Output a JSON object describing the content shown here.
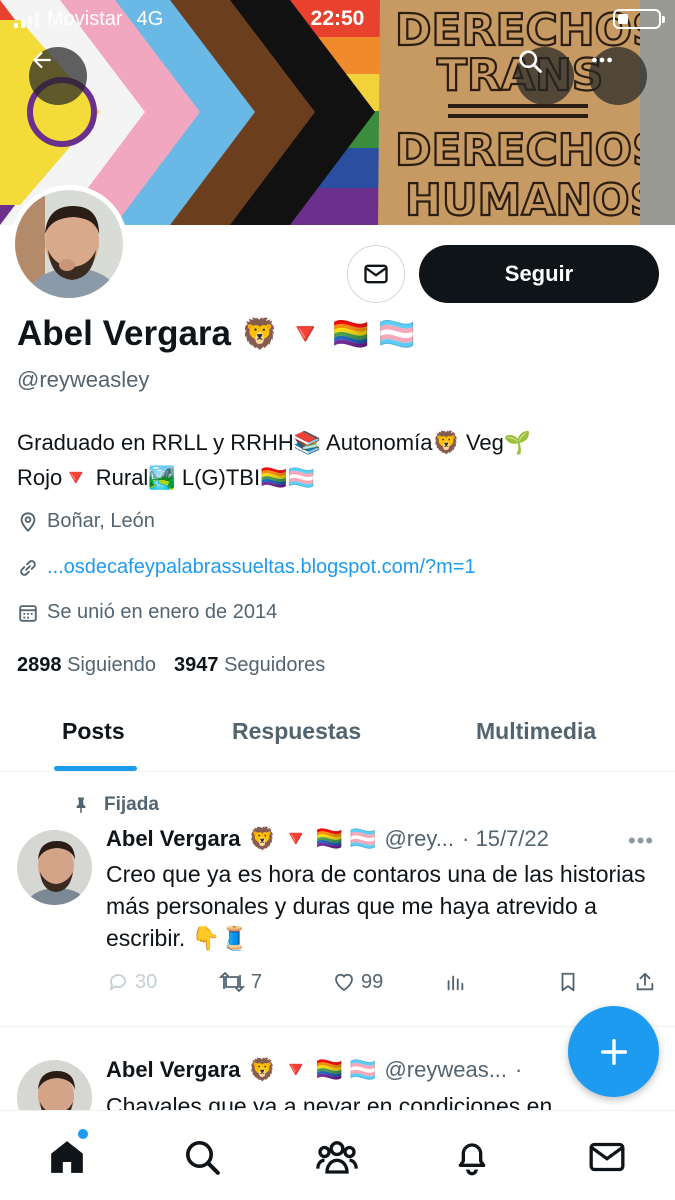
{
  "status_bar": {
    "carrier": "Movistar",
    "network": "4G",
    "time": "22:50"
  },
  "banner": {
    "sign_line1": "DERECHOS",
    "sign_line2": "TRANS",
    "sign_line3": "=",
    "sign_line4": "DERECHOS",
    "sign_line5": "HUMANOS"
  },
  "header": {
    "back_icon": "arrow-left-icon",
    "search_icon": "search-icon",
    "more_icon": "more-horizontal-icon"
  },
  "profile": {
    "name": "Abel Vergara",
    "name_emojis": "🦁 🔻 🏳️‍🌈 🏳️‍⚧️",
    "handle": "@reyweasley",
    "bio_line1": "Graduado en RRLL y RRHH📚 Autonomía🦁 Veg🌱",
    "bio_line2": "Rojo🔻 Rural🏞️ L(G)TBI🏳️‍🌈🏳️‍⚧️",
    "location": "Boñar, León",
    "link": "...osdecafeypalabrassueltas.blogspot.com/?m=1",
    "joined": "Se unió en enero de 2014",
    "following_count": "2898",
    "following_label": "Siguiendo",
    "followers_count": "3947",
    "followers_label": "Seguidores",
    "follow_button": "Seguir",
    "message_icon": "mail-icon"
  },
  "tabs": [
    {
      "label": "Posts",
      "active": true
    },
    {
      "label": "Respuestas",
      "active": false
    },
    {
      "label": "Multimedia",
      "active": false
    }
  ],
  "tweets": [
    {
      "pinned_label": "Fijada",
      "name": "Abel Vergara",
      "emojis": "🦁 🔻 🏳️‍🌈 🏳️‍⚧️",
      "handle": "@rey...",
      "date": "· 15/7/22",
      "text": "Creo que ya es hora de contaros una de las historias más personales y duras que me haya atrevido a escribir. 👇🧵",
      "replies": "30",
      "retweets": "7",
      "likes": "99"
    },
    {
      "name": "Abel Vergara",
      "emojis": "🦁 🔻 🏳️‍🌈 🏳️‍⚧️",
      "handle": "@reyweas...",
      "date": "·",
      "text": "Chavales que ya a nevar en condiciones en"
    }
  ],
  "bottom_nav": [
    {
      "icon": "home-icon"
    },
    {
      "icon": "search-icon"
    },
    {
      "icon": "communities-icon"
    },
    {
      "icon": "notifications-icon"
    },
    {
      "icon": "messages-icon"
    }
  ],
  "colors": {
    "accent": "#1d9bf0",
    "text": "#0f1419",
    "secondary_text": "#536471"
  }
}
